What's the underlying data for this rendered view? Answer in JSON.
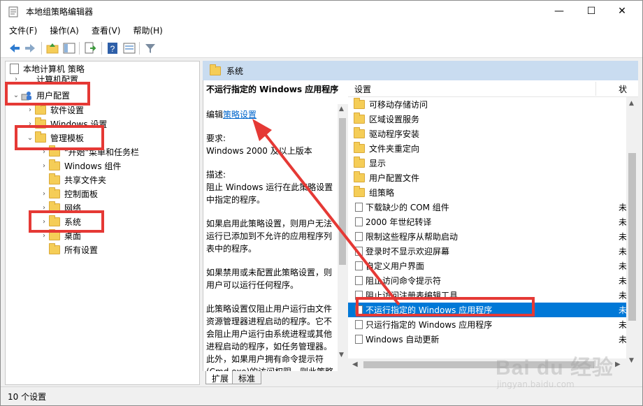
{
  "window": {
    "title": "本地组策略编辑器",
    "minimize": "—",
    "maximize": "☐",
    "close": "✕"
  },
  "menu": [
    "文件(F)",
    "操作(A)",
    "查看(V)",
    "帮助(H)"
  ],
  "tree": {
    "root": "本地计算机 策略",
    "computer_config": "计算机配置",
    "user_config": "用户配置",
    "software_settings": "软件设置",
    "windows_settings": "Windows 设置",
    "admin_templates": "管理模板",
    "start_menu": "\"开始\"菜单和任务栏",
    "windows_components": "Windows 组件",
    "shared_folders": "共享文件夹",
    "control_panel": "控制面板",
    "network": "网络",
    "system": "系统",
    "desktop": "桌面",
    "all_settings": "所有设置"
  },
  "header": {
    "folder_name": "系统"
  },
  "description": {
    "title": "不运行指定的 Windows 应用程序",
    "edit_prefix": "编辑",
    "edit_link": "策略设置",
    "requirement_label": "要求:",
    "requirement_value": "Windows 2000 及以上版本",
    "description_label": "描述:",
    "p1": "阻止 Windows 运行在此策略设置中指定的程序。",
    "p2": "如果启用此策略设置，则用户无法运行已添加到不允许的应用程序列表中的程序。",
    "p3": "如果禁用或未配置此策略设置，则用户可以运行任何程序。",
    "p4": "此策略设置仅阻止用户运行由文件资源管理器进程启动的程序。它不会阻止用户运行由系统进程或其他进程启动的程序，如任务管理器。此外，如果用户拥有命令提示符(Cmd.exe)的访问权限，则此策略"
  },
  "list": {
    "col_setting": "设置",
    "col_state": "状",
    "rows": [
      {
        "label": "可移动存储访问",
        "type": "folder",
        "state": ""
      },
      {
        "label": "区域设置服务",
        "type": "folder",
        "state": ""
      },
      {
        "label": "驱动程序安装",
        "type": "folder",
        "state": ""
      },
      {
        "label": "文件夹重定向",
        "type": "folder",
        "state": ""
      },
      {
        "label": "显示",
        "type": "folder",
        "state": ""
      },
      {
        "label": "用户配置文件",
        "type": "folder",
        "state": ""
      },
      {
        "label": "组策略",
        "type": "folder",
        "state": ""
      },
      {
        "label": "下载缺少的 COM 组件",
        "type": "setting",
        "state": "未"
      },
      {
        "label": "2000 年世纪转译",
        "type": "setting",
        "state": "未"
      },
      {
        "label": "限制这些程序从帮助启动",
        "type": "setting",
        "state": "未"
      },
      {
        "label": "登录时不显示欢迎屏幕",
        "type": "setting",
        "state": "未"
      },
      {
        "label": "自定义用户界面",
        "type": "setting",
        "state": "未"
      },
      {
        "label": "阻止访问命令提示符",
        "type": "setting",
        "state": "未"
      },
      {
        "label": "阻止访问注册表编辑工具",
        "type": "setting",
        "state": "未"
      },
      {
        "label": "不运行指定的 Windows 应用程序",
        "type": "setting",
        "state": "未",
        "selected": true
      },
      {
        "label": "只运行指定的 Windows 应用程序",
        "type": "setting",
        "state": "未"
      },
      {
        "label": "Windows 自动更新",
        "type": "setting",
        "state": "未"
      }
    ]
  },
  "tabs": [
    "扩展",
    "标准"
  ],
  "status": "10 个设置",
  "watermark": {
    "main": "Bai du 经验",
    "sub": "jingyan.baidu.com"
  },
  "colors": {
    "highlight": "#e53935",
    "selection": "#0078d7",
    "header_band": "#c9dcf0",
    "link": "#0066cc"
  }
}
